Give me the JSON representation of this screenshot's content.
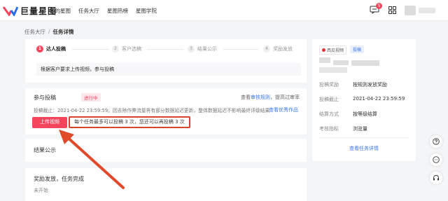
{
  "brand": {
    "name": "巨量星图",
    "accent": "#f5455c",
    "link": "#3a76f0",
    "highlight": "#d9452c"
  },
  "nav": {
    "items": [
      "我的星图",
      "任务大厅",
      "星图热榜",
      "星图学院"
    ],
    "message_count": "5"
  },
  "breadcrumb": {
    "parent": "任务大厅",
    "separator": "/",
    "current": "任务详情"
  },
  "steps": {
    "items": [
      {
        "num": "1",
        "label": "达人投稿",
        "active": true
      },
      {
        "num": "2",
        "label": "客户选稿",
        "active": false
      },
      {
        "num": "3",
        "label": "结果公示",
        "active": false
      },
      {
        "num": "4",
        "label": "奖励发放",
        "active": false
      }
    ],
    "description": "根据客户要求上传视频，参与投稿"
  },
  "submission": {
    "title": "参与投稿",
    "status": "进行中",
    "rules_prefix": "查看",
    "rules_link": "审核规则",
    "rules_suffix": "，提高过审率",
    "deadline": "投稿截止：2021-04-22 23:59:59。因去除作弊流量将有部分数据延迟更新，整体数据延迟不影响最终评级结果",
    "view_best": "查看优秀作品",
    "upload_button": "上传视频",
    "limit_note": "每个任务最多可以投稿 3 次，您还可以再投稿 3 次"
  },
  "result": {
    "title": "结果公示"
  },
  "reward": {
    "title": "奖励发放，任务完成",
    "status": "未开始"
  },
  "side": {
    "source_tag": "西瓜视频",
    "type_tag": "投稿",
    "rows": [
      {
        "key": "投稿奖励",
        "value": "按规则发放奖励"
      },
      {
        "key": "投稿截止",
        "value": "2021-04-22 23:59:59"
      },
      {
        "key": "结算方式",
        "value": "按等级结算"
      },
      {
        "key": "考核指标",
        "value": "浏览量"
      }
    ],
    "detail_link": "查看任务详情"
  },
  "icons": {
    "logo": "star-logo-icon",
    "messages": "message-icon",
    "apps": "apps-grid-icon",
    "help": "help-icon",
    "feedback": "feedback-icon",
    "support": "headset-icon",
    "annotation": "red-arrow-icon"
  }
}
